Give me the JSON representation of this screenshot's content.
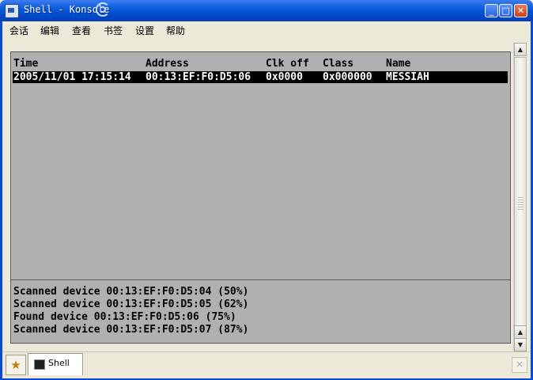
{
  "window": {
    "title": "Shell - Konsole",
    "minimize_label": "_",
    "maximize_label": "□",
    "close_label": "✕"
  },
  "menu": {
    "items": [
      "会话",
      "编辑",
      "查看",
      "书签",
      "设置",
      "帮助"
    ]
  },
  "device_table": {
    "headers": [
      "Time",
      "Address",
      "Clk off",
      "Class",
      "Name"
    ],
    "rows": [
      [
        "2005/11/01 17:15:14",
        "00:13:EF:F0:D5:06",
        "0x0000",
        "0x000000",
        "MESSIAH"
      ]
    ]
  },
  "log": {
    "lines": [
      "Scanned device 00:13:EF:F0:D5:04 (50%)",
      "Scanned device 00:13:EF:F0:D5:05 (62%)",
      "Found device 00:13:EF:F0:D5:06 (75%)",
      "Scanned device 00:13:EF:F0:D5:07 (87%)"
    ]
  },
  "scrollbar": {
    "up_arrow": "▲",
    "down_arrow": "▼"
  },
  "tabs": {
    "new_tab_icon": "★",
    "items": [
      {
        "label": "Shell"
      }
    ],
    "close_icon": "✕"
  }
}
